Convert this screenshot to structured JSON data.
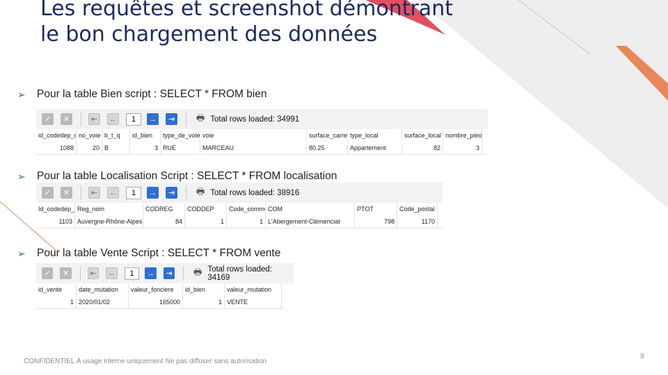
{
  "slide": {
    "title": "Les requêtes et screenshot démontrant le bon chargement des données",
    "footer": "CONFIDENTIEL À usage interne uniquement Ne pas diffuser sans autorisation",
    "page_number": "9",
    "accent_colors": {
      "red": "#e05060",
      "orange": "#e8875a",
      "gray": "#e5e5e5",
      "title": "#1b2a5e",
      "bullet": "#2e7d32"
    }
  },
  "sections": [
    {
      "bullet": "Pour la table Bien  script : SELECT * FROM bien",
      "toolbar": {
        "page": "1",
        "total": "Total rows loaded: 34991"
      },
      "columns": [
        "id_codedep_c",
        "no_voie",
        "b_t_q",
        "id_bien",
        "type_de_voie",
        "voie",
        "surface_carre",
        "type_local",
        "surface_local",
        "nombre_pieo"
      ],
      "row": [
        "1088",
        "20",
        "B",
        "3",
        "RUE",
        "MARCEAU",
        "80.25",
        "Appartement",
        "82",
        "3"
      ]
    },
    {
      "bullet": "Pour la table Localisation  Script : SELECT * FROM localisation",
      "toolbar": {
        "page": "1",
        "total": "Total rows loaded: 38916"
      },
      "columns": [
        "Id_codedep_c",
        "Reg_nom",
        "CODREG",
        "CODDEP",
        "Code_commu",
        "COM",
        "PTOT",
        "Code_postal"
      ],
      "row": [
        "1103",
        "Auvergne-Rhône-Alpes",
        "84",
        "1",
        "1",
        "L'Abergement-Clémenciat",
        "798",
        "1170"
      ]
    },
    {
      "bullet": "Pour la table Vente Script : SELECT * FROM vente",
      "toolbar": {
        "page": "1",
        "total": "Total rows loaded: 34169"
      },
      "columns": [
        "id_vente",
        "date_mutation",
        "valeur_fonciere",
        "id_bien",
        "valeur_mutation"
      ],
      "row": [
        "1",
        "2020/01/02",
        "165000",
        "1",
        "VENTE"
      ]
    }
  ]
}
